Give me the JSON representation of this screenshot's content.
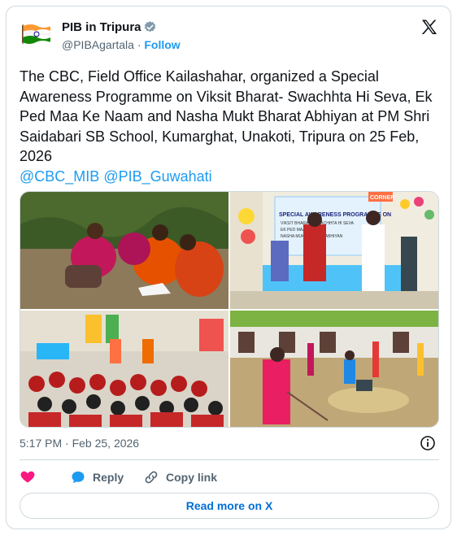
{
  "author": {
    "name": "PIB in Tripura",
    "handle": "@PIBAgartala",
    "separator": "·",
    "follow_label": "Follow",
    "avatar_icon": "india-flag-icon",
    "verified_icon": "verified-badge-icon"
  },
  "tweet": {
    "text": "The CBC, Field Office Kailashahar, organized a Special Awareness Programme on Viksit Bharat- Swachhta Hi Seva, Ek Ped Maa Ke Naam and Nasha Mukt Bharat Abhiyan at PM Shri Saidabari SB School, Kumarghat, Unakoti, Tripura on 25 Feb, 2026",
    "mention_1": "@CBC_MIB",
    "mention_2": "@PIB_Guwahati",
    "timestamp": "5:17 PM · Feb 25, 2026"
  },
  "banner": {
    "line1": "SPECIAL AWARENESS PROGRAMME ON",
    "line2": "VIKSIT BHARAT · SWACHHTA HI SEVA",
    "line3": "EK PED MAA KE NAAM",
    "line4": "NASHA MUKT BHARAT ABHIYAN",
    "corner_label": "CORNER"
  },
  "actions": {
    "like_icon": "heart-icon",
    "reply_icon": "reply-bubble-icon",
    "reply_label": "Reply",
    "copy_icon": "link-icon",
    "copy_label": "Copy link",
    "read_more_label": "Read more on X"
  },
  "colors": {
    "link": "#1d9bf0",
    "like": "#f91880",
    "text": "#0f1419",
    "secondary": "#536471",
    "border": "#cfd9de"
  }
}
